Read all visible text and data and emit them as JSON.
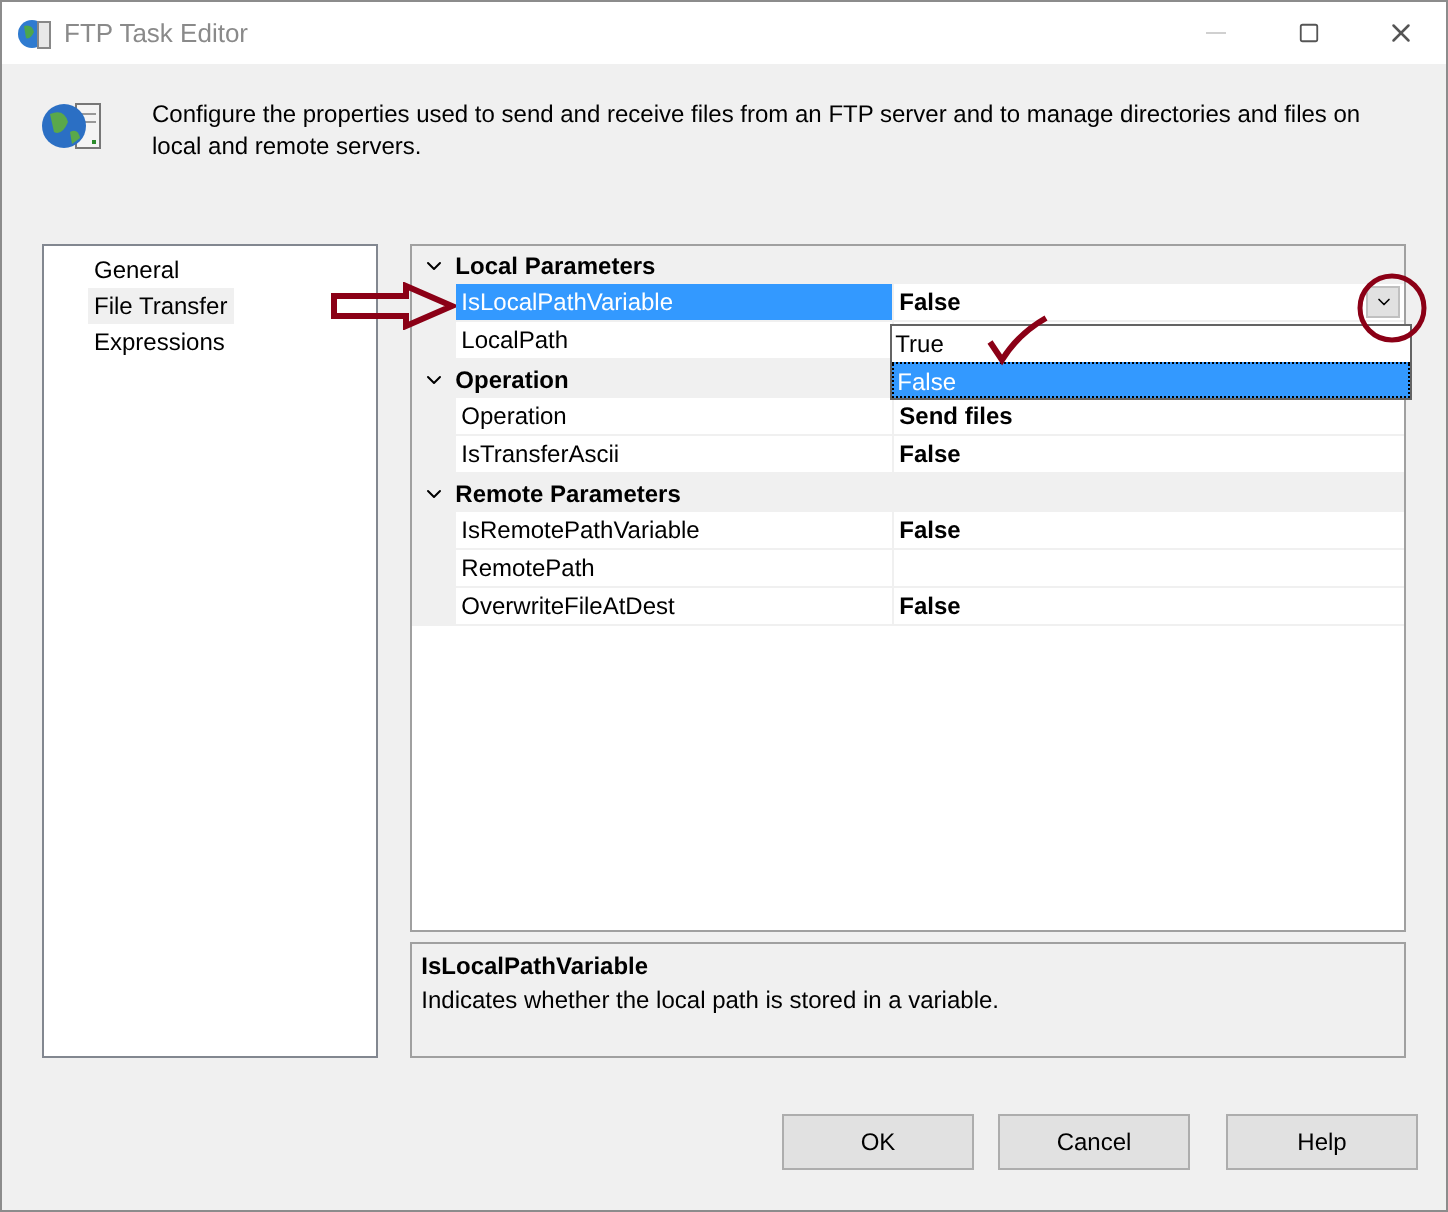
{
  "window": {
    "title": "FTP Task Editor"
  },
  "header": {
    "text": "Configure the properties used to send and receive files from an FTP server and to manage directories and files on local and remote servers."
  },
  "sidebar": {
    "items": [
      {
        "label": "General",
        "selected": false
      },
      {
        "label": "File Transfer",
        "selected": true
      },
      {
        "label": "Expressions",
        "selected": false
      }
    ]
  },
  "property_grid": {
    "groups": [
      {
        "title": "Local Parameters",
        "expanded": true,
        "rows": [
          {
            "label": "IsLocalPathVariable",
            "value": "False",
            "selected": true,
            "dropdown": true
          },
          {
            "label": "LocalPath",
            "selected": false
          }
        ]
      },
      {
        "title": "Operation",
        "expanded": true,
        "rows": [
          {
            "label": "Operation",
            "value": "Send files",
            "selected": false
          },
          {
            "label": "IsTransferAscii",
            "value": "False",
            "selected": false
          }
        ]
      },
      {
        "title": "Remote Parameters",
        "expanded": true,
        "rows": [
          {
            "label": "IsRemotePathVariable",
            "value": "False",
            "selected": false
          },
          {
            "label": "RemotePath",
            "selected": false
          },
          {
            "label": "OverwriteFileAtDest",
            "value": "False",
            "selected": false
          }
        ]
      }
    ],
    "dropdown_list": [
      {
        "label": "True",
        "selected": false
      },
      {
        "label": "False",
        "selected": true
      }
    ]
  },
  "description": {
    "title": "IsLocalPathVariable",
    "text": "Indicates whether the local path is stored in a variable."
  },
  "buttons": [
    "OK",
    "Cancel",
    "Help"
  ]
}
